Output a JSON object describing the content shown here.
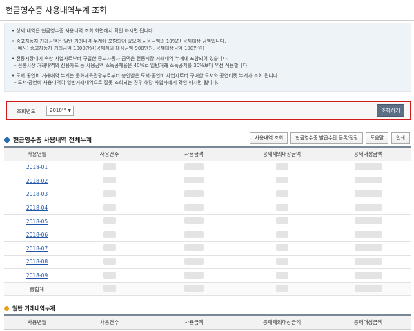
{
  "header": {
    "title": "현금영수증 사용내역누계 조회"
  },
  "notice": {
    "lines": [
      "• 상세 내역은 현금영수증 사용내역 조회 화면에서 확인 하시면 됩니다.",
      "• 중고자동차 거래금액은 일반 거래내역 누계에 포함되어 있으며 사용금액의 10%만 공제대상 금액입니다.",
      "  - 예시) 중고자동차 거래금액 1000만원(공제제외 대상금액 900만원, 공제대상금액 100만원)",
      "• 전통시장내에 속한 사업자로부터 구입한 중고자동차 금액은 전통시장 거래내역 누계에 포함되어 있습니다.",
      "  - 전통시장 거래내역의 신용카드 등 사용금액 소득공제율은 40%로 일반거래 소득공제를 30%보다 우선 적용합니다.",
      "• 도서·공연비 거래내역 누계는 문화체육관광부로부터 승인받은 도서·공연비 사업자로터 구매한 도서와 공연티켓 누계가 조회 됩니다.",
      "  - 도서·공연비 사용내역이 일반거래내역으로 잘못 조회되는 경우 해당 사업자에게 확인 하시면 됩니다."
    ]
  },
  "filter": {
    "label": "조회년도",
    "selected_year": "2018년",
    "search_button": "조회하기"
  },
  "section1": {
    "title": "현금영수증 사용내역 전체누계",
    "buttons": [
      "사용내역 조회",
      "현금영수증 발급수단 등록/정정",
      "도움말",
      "인쇄"
    ],
    "columns": [
      "사용년월",
      "사용건수",
      "사용금액",
      "공제제외대상금액",
      "공제대상금액"
    ],
    "months": [
      "2018-01",
      "2018-02",
      "2018-03",
      "2018-04",
      "2018-05",
      "2018-06",
      "2018-07",
      "2018-08",
      "2018-09"
    ],
    "total_label": "총합계"
  },
  "section2": {
    "title": "일반 거래내역누계",
    "columns": [
      "사용년월",
      "사용건수",
      "사용금액",
      "공제제외대상금액",
      "공제대상금액"
    ]
  },
  "colors": {
    "accent_red": "#d11a1a",
    "button_dark": "#5d6f85",
    "link_blue": "#1f54a8"
  }
}
